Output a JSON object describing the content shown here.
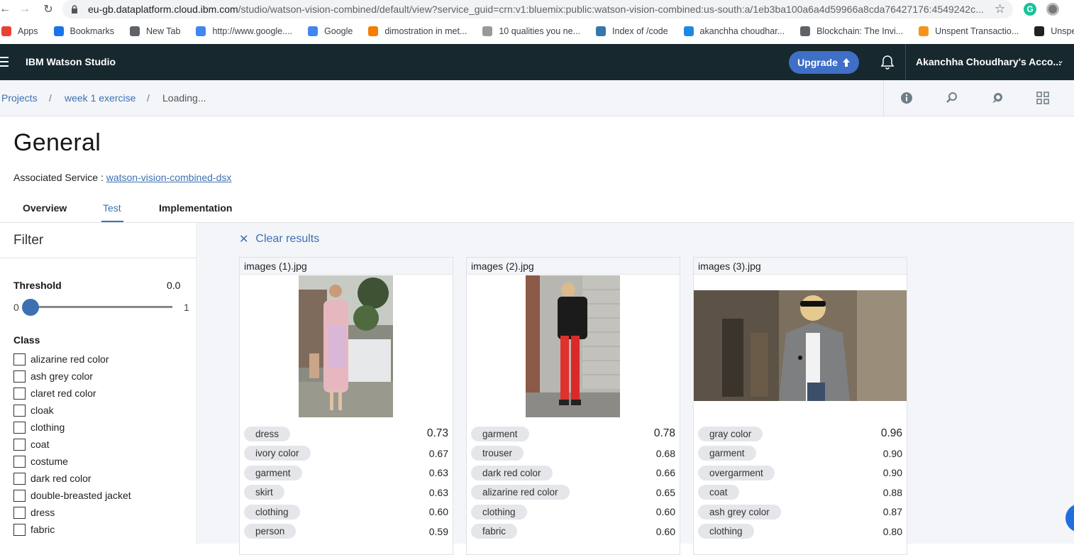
{
  "browser": {
    "url_host": "eu-gb.dataplatform.cloud.ibm.com",
    "url_path": "/studio/watson-vision-combined/default/view?service_guid=crn:v1:bluemix:public:watson-vision-combined:us-south:a/1eb3ba100a6a4d59966a8cda76427176:4549242c...",
    "bookmarks": [
      {
        "label": "Apps",
        "icon": "apps-grid-icon",
        "color": "#e94235"
      },
      {
        "label": "Bookmarks",
        "icon": "star-icon",
        "color": "#1a73e8"
      },
      {
        "label": "New Tab",
        "icon": "globe-icon",
        "color": "#5f6368"
      },
      {
        "label": "http://www.google....",
        "icon": "google-icon",
        "color": "#4285f4"
      },
      {
        "label": "Google",
        "icon": "google-icon",
        "color": "#4285f4"
      },
      {
        "label": "dimostration in met...",
        "icon": "blogger-icon",
        "color": "#f57d00"
      },
      {
        "label": "10 qualities you ne...",
        "icon": "page-icon",
        "color": "#999999"
      },
      {
        "label": "Index of /code",
        "icon": "python-icon",
        "color": "#3776ab"
      },
      {
        "label": "akanchha choudhar...",
        "icon": "dq-icon",
        "color": "#1e88e5"
      },
      {
        "label": "Blockchain: The Invi...",
        "icon": "globe-icon",
        "color": "#5f6368"
      },
      {
        "label": "Unspent Transactio...",
        "icon": "bitcoin-icon",
        "color": "#f7931a"
      },
      {
        "label": "Unspent Transactio...",
        "icon": "s-logo-icon",
        "color": "#222222"
      }
    ]
  },
  "header": {
    "brand": "IBM Watson Studio",
    "upgrade_label": "Upgrade",
    "account": "Akanchha Choudhary's Acco..."
  },
  "breadcrumb": {
    "items": [
      "Projects",
      "week 1 exercise",
      "Loading..."
    ],
    "separator": "/"
  },
  "page": {
    "title": "General",
    "assoc_label": "Associated Service :",
    "assoc_link": "watson-vision-combined-dsx",
    "tabs": [
      {
        "label": "Overview",
        "active": false
      },
      {
        "label": "Test",
        "active": true
      },
      {
        "label": "Implementation",
        "active": false
      }
    ]
  },
  "filter": {
    "title": "Filter",
    "threshold_label": "Threshold",
    "threshold_value": "0.0",
    "threshold_fraction": 0.0,
    "slider_min": "0",
    "slider_max": "1",
    "class_label": "Class",
    "classes": [
      "alizarine red color",
      "ash grey color",
      "claret red color",
      "cloak",
      "clothing",
      "coat",
      "costume",
      "dark red color",
      "double-breasted jacket",
      "dress",
      "fabric"
    ]
  },
  "results": {
    "clear_label": "Clear results",
    "cards": [
      {
        "filename": "images (1).jpg",
        "tags": [
          {
            "label": "dress",
            "score": "0.73"
          },
          {
            "label": "ivory color",
            "score": "0.67"
          },
          {
            "label": "garment",
            "score": "0.63"
          },
          {
            "label": "skirt",
            "score": "0.63"
          },
          {
            "label": "clothing",
            "score": "0.60"
          },
          {
            "label": "person",
            "score": "0.59"
          }
        ]
      },
      {
        "filename": "images (2).jpg",
        "tags": [
          {
            "label": "garment",
            "score": "0.78"
          },
          {
            "label": "trouser",
            "score": "0.68"
          },
          {
            "label": "dark red color",
            "score": "0.66"
          },
          {
            "label": "alizarine red color",
            "score": "0.65"
          },
          {
            "label": "clothing",
            "score": "0.60"
          },
          {
            "label": "fabric",
            "score": "0.60"
          }
        ]
      },
      {
        "filename": "images (3).jpg",
        "tags": [
          {
            "label": "gray color",
            "score": "0.96"
          },
          {
            "label": "garment",
            "score": "0.90"
          },
          {
            "label": "overgarment",
            "score": "0.90"
          },
          {
            "label": "coat",
            "score": "0.88"
          },
          {
            "label": "ash grey color",
            "score": "0.87"
          },
          {
            "label": "clothing",
            "score": "0.80"
          }
        ]
      }
    ]
  },
  "colors": {
    "accent": "#3d70b2",
    "header_bg": "#17282f",
    "upgrade_bg": "#3f6fc6"
  }
}
